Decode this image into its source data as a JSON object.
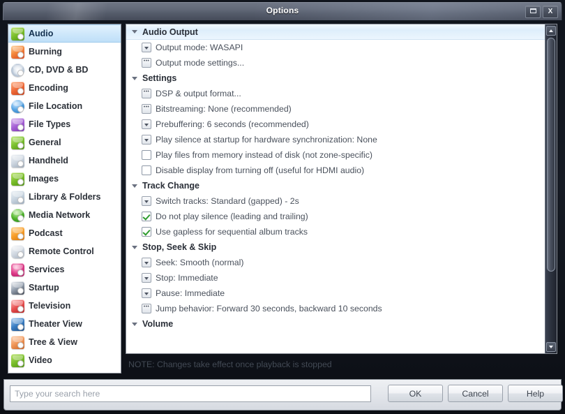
{
  "window": {
    "title": "Options",
    "maximize_label": "maximize",
    "close_label": "X"
  },
  "sidebar": {
    "items": [
      {
        "label": "Audio",
        "icon": "audio-icon",
        "icon_class": "ic-audio",
        "selected": true
      },
      {
        "label": "Burning",
        "icon": "burning-icon",
        "icon_class": "ic-burning",
        "selected": false
      },
      {
        "label": "CD, DVD & BD",
        "icon": "disc-icon",
        "icon_class": "ic-cd",
        "selected": false
      },
      {
        "label": "Encoding",
        "icon": "encoding-icon",
        "icon_class": "ic-enc",
        "selected": false
      },
      {
        "label": "File Location",
        "icon": "file-location-icon",
        "icon_class": "ic-floc",
        "selected": false
      },
      {
        "label": "File Types",
        "icon": "file-types-icon",
        "icon_class": "ic-ftypes",
        "selected": false
      },
      {
        "label": "General",
        "icon": "general-icon",
        "icon_class": "ic-general",
        "selected": false
      },
      {
        "label": "Handheld",
        "icon": "handheld-icon",
        "icon_class": "ic-hand",
        "selected": false
      },
      {
        "label": "Images",
        "icon": "images-icon",
        "icon_class": "ic-images",
        "selected": false
      },
      {
        "label": "Library & Folders",
        "icon": "library-folders-icon",
        "icon_class": "ic-lib",
        "selected": false
      },
      {
        "label": "Media Network",
        "icon": "media-network-icon",
        "icon_class": "ic-mnet",
        "selected": false
      },
      {
        "label": "Podcast",
        "icon": "podcast-icon",
        "icon_class": "ic-pod",
        "selected": false
      },
      {
        "label": "Remote Control",
        "icon": "remote-control-icon",
        "icon_class": "ic-remote",
        "selected": false
      },
      {
        "label": "Services",
        "icon": "services-icon",
        "icon_class": "ic-serv",
        "selected": false
      },
      {
        "label": "Startup",
        "icon": "startup-icon",
        "icon_class": "ic-start",
        "selected": false
      },
      {
        "label": "Television",
        "icon": "television-icon",
        "icon_class": "ic-tv",
        "selected": false
      },
      {
        "label": "Theater View",
        "icon": "theater-view-icon",
        "icon_class": "ic-theater",
        "selected": false
      },
      {
        "label": "Tree & View",
        "icon": "tree-view-icon",
        "icon_class": "ic-tree",
        "selected": false
      },
      {
        "label": "Video",
        "icon": "video-icon",
        "icon_class": "ic-video",
        "selected": false
      }
    ]
  },
  "content": {
    "sections": [
      {
        "title": "Audio Output",
        "expanded": true,
        "highlighted": true,
        "rows": [
          {
            "label": "Output mode: WASAPI",
            "control": "dropdown",
            "checked": false
          },
          {
            "label": "Output mode settings...",
            "control": "ellipsis",
            "checked": false
          }
        ]
      },
      {
        "title": "Settings",
        "expanded": true,
        "highlighted": false,
        "rows": [
          {
            "label": "DSP & output format...",
            "control": "ellipsis",
            "checked": false
          },
          {
            "label": "Bitstreaming: None (recommended)",
            "control": "ellipsis",
            "checked": false
          },
          {
            "label": "Prebuffering: 6 seconds (recommended)",
            "control": "dropdown",
            "checked": false
          },
          {
            "label": "Play silence at startup for hardware synchronization: None",
            "control": "dropdown",
            "checked": false
          },
          {
            "label": "Play files from memory instead of disk (not zone-specific)",
            "control": "checkbox",
            "checked": false
          },
          {
            "label": "Disable display from turning off (useful for HDMI audio)",
            "control": "checkbox",
            "checked": false
          }
        ]
      },
      {
        "title": "Track Change",
        "expanded": true,
        "highlighted": false,
        "rows": [
          {
            "label": "Switch tracks: Standard (gapped) - 2s",
            "control": "dropdown",
            "checked": false
          },
          {
            "label": "Do not play silence (leading and trailing)",
            "control": "checkbox",
            "checked": true
          },
          {
            "label": "Use gapless for sequential album tracks",
            "control": "checkbox",
            "checked": true
          }
        ]
      },
      {
        "title": "Stop, Seek & Skip",
        "expanded": true,
        "highlighted": false,
        "rows": [
          {
            "label": "Seek: Smooth (normal)",
            "control": "dropdown",
            "checked": false
          },
          {
            "label": "Stop: Immediate",
            "control": "dropdown",
            "checked": false
          },
          {
            "label": "Pause: Immediate",
            "control": "dropdown",
            "checked": false
          },
          {
            "label": "Jump behavior: Forward 30 seconds, backward 10 seconds",
            "control": "ellipsis",
            "checked": false
          }
        ]
      },
      {
        "title": "Volume",
        "expanded": true,
        "highlighted": false,
        "rows": []
      }
    ]
  },
  "note": "NOTE: Changes take effect once playback is stopped",
  "bottom": {
    "search_value": "",
    "search_placeholder": "Type your search here",
    "ok_label": "OK",
    "cancel_label": "Cancel",
    "help_label": "Help"
  },
  "scrollbar": {
    "up_label": "scroll-up",
    "down_label": "scroll-down"
  },
  "colors": {
    "titlebar": "#5a6170",
    "selection": "#cfe8fb",
    "check_green": "#2f9c2f",
    "panel_bg": "#ffffff",
    "frame": "#0d1117"
  }
}
